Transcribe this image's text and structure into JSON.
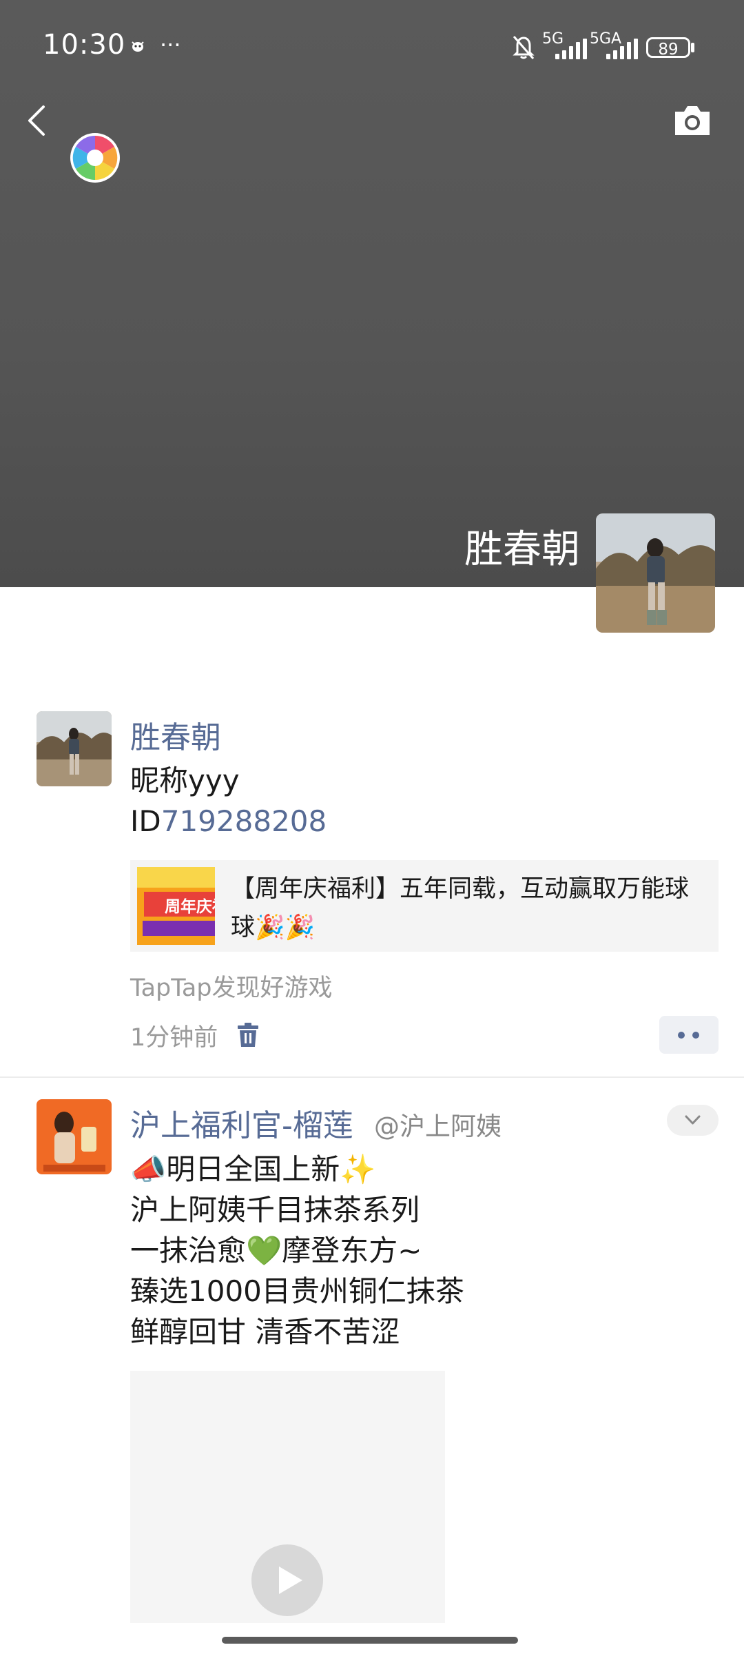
{
  "status_bar": {
    "time": "10:30",
    "more_dots": "···",
    "network_1": "5G",
    "network_2": "5GA",
    "battery": "89"
  },
  "header": {
    "back_icon": "chevron-left-icon",
    "camera_icon": "camera-icon",
    "profile_name": "胜春朝"
  },
  "post1": {
    "name": "胜春朝",
    "line1": "昵称yyy",
    "id_prefix": "ID",
    "id_value": "719288208",
    "link_title": "【周年庆福利】五年同载，互动赢取万能球球🎉🎉",
    "thumb_text": "周年庆福",
    "source": "TapTap发现好游戏",
    "time": "1分钟前"
  },
  "post2": {
    "name": "沪上福利官-榴莲",
    "mention": "@沪上阿姨",
    "lines": [
      "📣明日全国上新✨",
      "沪上阿姨千目抹茶系列",
      "一抹治愈💚摩登东方~",
      "臻选1000目贵州铜仁抹茶",
      "鲜醇回甘 清香不苦涩"
    ]
  },
  "colors": {
    "link_blue": "#576b95",
    "cover_gray": "#555555"
  }
}
